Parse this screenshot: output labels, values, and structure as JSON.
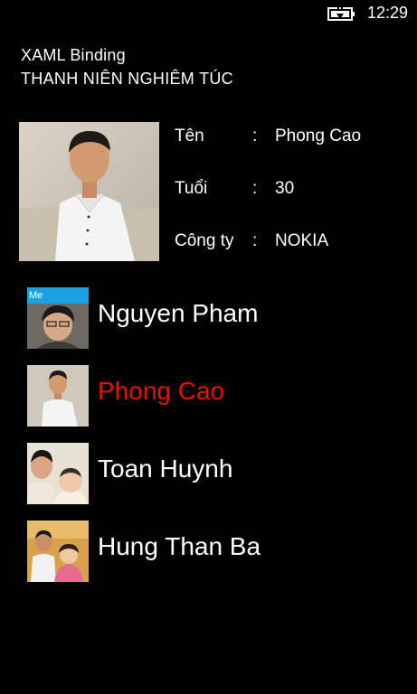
{
  "status_bar": {
    "time": "12:29",
    "battery_icon": "battery-charging-icon"
  },
  "app_title": "XAML Binding",
  "page_title": "THANH NIÊN NGHIÊM TÚC",
  "details": [
    {
      "label": "Tên",
      "separator": ":",
      "value": "Phong Cao"
    },
    {
      "label": "Tuổi",
      "separator": ":",
      "value": "30"
    },
    {
      "label": "Công ty",
      "separator": ":",
      "value": "NOKIA"
    }
  ],
  "people": [
    {
      "name": "Nguyen Pham",
      "badge": "Me",
      "selected": false
    },
    {
      "name": "Phong Cao",
      "selected": true
    },
    {
      "name": "Toan Huynh",
      "selected": false
    },
    {
      "name": "Hung Than Ba",
      "selected": false
    }
  ],
  "colors": {
    "background": "#000000",
    "selected": "#e51400",
    "accent": "#1ba1e2"
  }
}
